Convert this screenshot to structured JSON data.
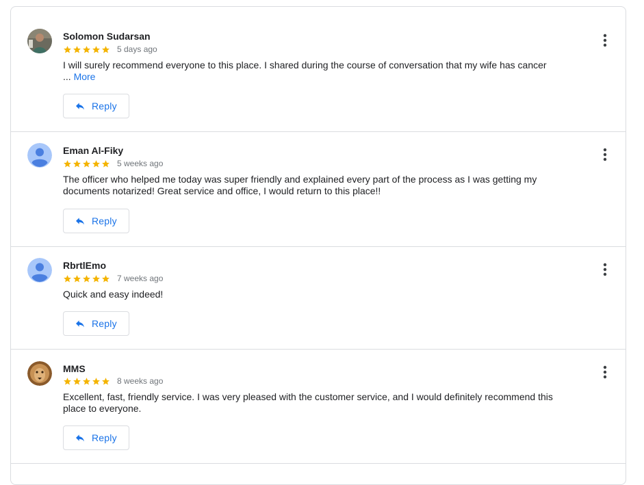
{
  "reviews": [
    {
      "author": "Solomon Sudarsan",
      "rating": 5,
      "date": "5 days ago",
      "text": "I will surely recommend everyone to this place. I shared during the course of conversation that my wife has cancer",
      "ellipsis": "...",
      "more_label": "More",
      "reply_label": "Reply",
      "avatar": "photo-person"
    },
    {
      "author": "Eman Al-Fiky",
      "rating": 5,
      "date": "5 weeks ago",
      "text": "The officer who helped me today was super friendly and explained every part of the process as I was getting my documents notarized! Great service and office, I would return to this place!!",
      "reply_label": "Reply",
      "avatar": "default-person"
    },
    {
      "author": "RbrtlEmo",
      "rating": 5,
      "date": "7 weeks ago",
      "text": "Quick and easy indeed!",
      "reply_label": "Reply",
      "avatar": "default-person"
    },
    {
      "author": "MMS",
      "rating": 5,
      "date": "8 weeks ago",
      "text": "Excellent, fast, friendly service. I was very pleased with the customer service, and I would definitely recommend this place to everyone.",
      "reply_label": "Reply",
      "avatar": "photo-lion"
    }
  ],
  "colors": {
    "star": "#f4b400",
    "link": "#1a73e8",
    "border": "#dadce0",
    "default_avatar_bg": "#a8c7fa",
    "default_avatar_fg": "#4a7fe0"
  }
}
